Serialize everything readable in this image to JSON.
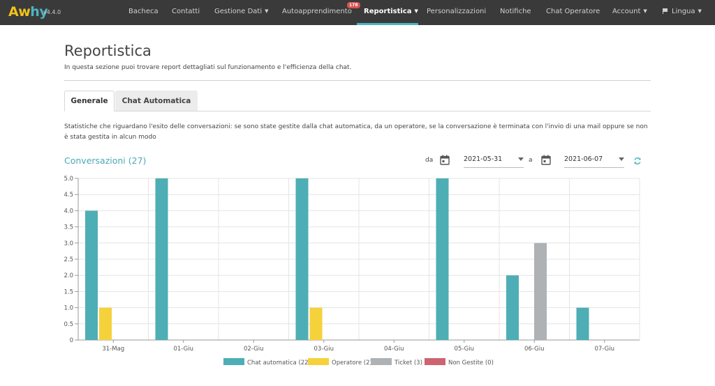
{
  "app": {
    "version": "v4.4.0"
  },
  "nav": {
    "items": [
      {
        "label": "Bacheca"
      },
      {
        "label": "Contatti"
      },
      {
        "label": "Gestione Dati"
      },
      {
        "label": "Autoapprendimento",
        "badge": "178"
      },
      {
        "label": "Reportistica"
      },
      {
        "label": "Personalizzazioni"
      },
      {
        "label": "Notifiche"
      },
      {
        "label": "Chat Operatore"
      },
      {
        "label": "Account"
      },
      {
        "label": "Lingua"
      }
    ],
    "active": "Reportistica"
  },
  "page": {
    "title": "Reportistica",
    "subtitle": "In questa sezione puoi trovare report dettagliati sul funzionamento e l'efficienza della chat."
  },
  "tabs": [
    {
      "label": "Generale"
    },
    {
      "label": "Chat Automatica"
    }
  ],
  "description": "Statistiche che riguardano l'esito delle conversazioni: se sono state gestite dalla chat automatica, da un operatore, se la conversazione è terminata con l'invio di una mail oppure se non è stata gestita in alcun modo",
  "filters": {
    "from_label": "da",
    "from_date": "2021-05-31",
    "to_label": "a",
    "to_date": "2021-06-07"
  },
  "colors": {
    "accent": "#4cb4c4",
    "chat_automatica": "#4eaeb5",
    "operatore": "#f5d23c",
    "ticket": "#aeb2b4",
    "non_gestite": "#cd6470"
  },
  "chart_data": {
    "type": "bar",
    "title": "Conversazioni (27)",
    "categories": [
      "31-Mag",
      "01-Giu",
      "02-Giu",
      "03-Giu",
      "04-Giu",
      "05-Giu",
      "06-Giu",
      "07-Giu"
    ],
    "series": [
      {
        "name": "Chat automatica (22)",
        "values": [
          4,
          5,
          0,
          5,
          0,
          5,
          2,
          1
        ]
      },
      {
        "name": "Operatore (2)",
        "values": [
          1,
          0,
          0,
          1,
          0,
          0,
          0,
          0
        ]
      },
      {
        "name": "Ticket (3)",
        "values": [
          0,
          0,
          0,
          0,
          0,
          0,
          3,
          0
        ]
      },
      {
        "name": "Non Gestite (0)",
        "values": [
          0,
          0,
          0,
          0,
          0,
          0,
          0,
          0
        ]
      }
    ],
    "yticks": [
      "0",
      "0.5",
      "1.0",
      "1.5",
      "2.0",
      "2.5",
      "3.0",
      "3.5",
      "4.0",
      "4.5",
      "5.0"
    ],
    "ylim": [
      0,
      5
    ],
    "grid": true,
    "legend": "bottom"
  }
}
